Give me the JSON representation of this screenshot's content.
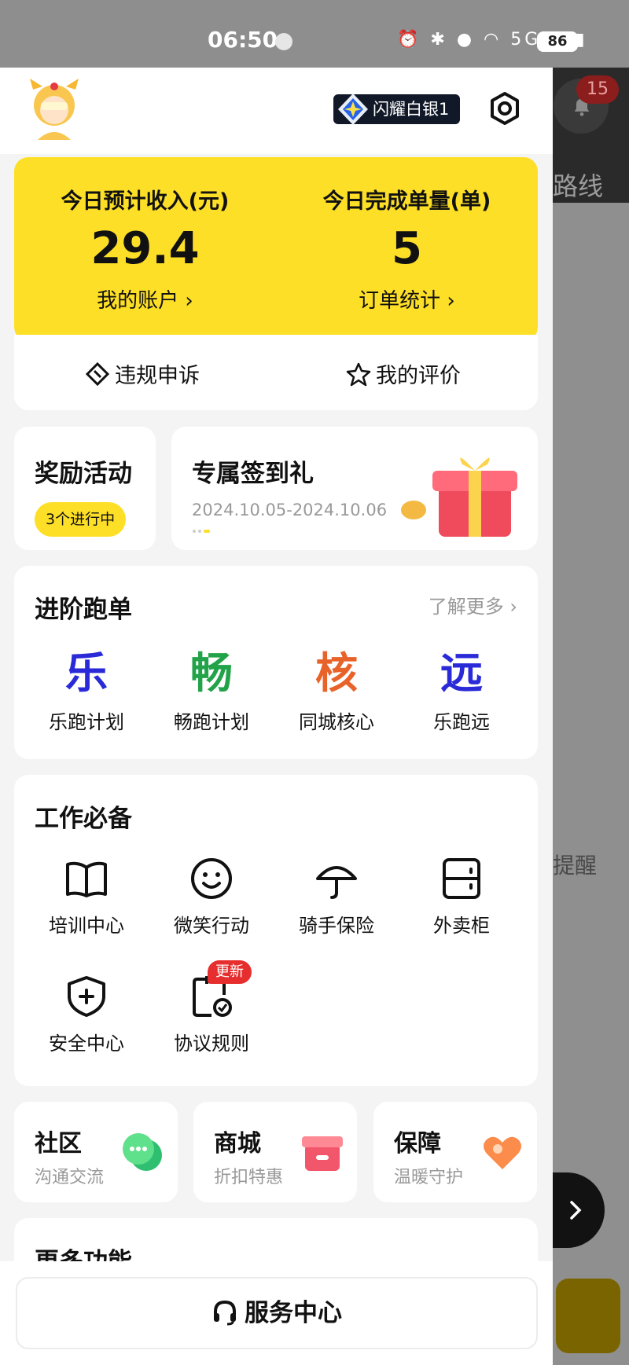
{
  "status_bar": {
    "time": "06:50",
    "network": "5G",
    "battery": "86"
  },
  "header": {
    "rank_badge": "闪耀白银1"
  },
  "income": {
    "left_label": "今日预计收入(元)",
    "left_value": "29.4",
    "left_link": "我的账户 ›",
    "right_label": "今日完成单量(单)",
    "right_value": "5",
    "right_link": "订单统计 ›"
  },
  "quick_links": {
    "appeal": "违规申诉",
    "rating": "我的评价"
  },
  "reward": {
    "title": "奖励活动",
    "pill": "3个进行中"
  },
  "checkin": {
    "title": "专属签到礼",
    "date": "2024.10.05-2024.10.06"
  },
  "advance": {
    "title": "进阶跑单",
    "more": "了解更多 ›",
    "items": [
      {
        "glyph": "乐",
        "name": "乐跑计划",
        "color": "#2a2ad8"
      },
      {
        "glyph": "畅",
        "name": "畅跑计划",
        "color": "#22a34a"
      },
      {
        "glyph": "核",
        "name": "同城核心",
        "color": "#e8632a"
      },
      {
        "glyph": "远",
        "name": "乐跑远",
        "color": "#2a2ad8"
      }
    ]
  },
  "work": {
    "title": "工作必备",
    "tools": [
      {
        "icon": "book-icon",
        "name": "培训中心"
      },
      {
        "icon": "smile-icon",
        "name": "微笑行动"
      },
      {
        "icon": "umbrella-icon",
        "name": "骑手保险"
      },
      {
        "icon": "locker-icon",
        "name": "外卖柜"
      },
      {
        "icon": "shield-plus-icon",
        "name": "安全中心"
      },
      {
        "icon": "agreement-icon",
        "name": "协议规则"
      }
    ],
    "new_badge": "更新"
  },
  "mini_cards": [
    {
      "title": "社区",
      "subtitle": "沟通交流"
    },
    {
      "title": "商城",
      "subtitle": "折扣特惠"
    },
    {
      "title": "保障",
      "subtitle": "温暖守护"
    }
  ],
  "more": {
    "title": "更多功能"
  },
  "footer": {
    "service": "服务中心"
  },
  "background_app": {
    "notification_count": "15",
    "route_text": "路线",
    "remind_text": "提醒"
  },
  "colors": {
    "accent_yellow": "#fddf27",
    "badge_red": "#e62e2e"
  }
}
